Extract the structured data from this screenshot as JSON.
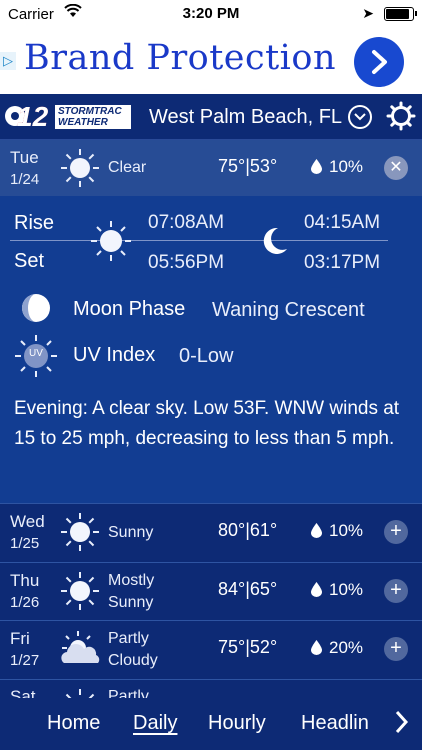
{
  "status_bar": {
    "carrier": "Carrier",
    "time": "3:20 PM",
    "battery_level": 0.9
  },
  "ad": {
    "text": "Brand Protection",
    "adchoices_glyph": "▷"
  },
  "header": {
    "logo_number": "12",
    "logo_line1": "STORMTRAC",
    "logo_line2": "WEATHER",
    "city": "West Palm Beach, FL"
  },
  "selected_day": {
    "day": "Tue",
    "date": "1/24",
    "condition": "Clear",
    "icon": "sun-icon",
    "hi": "75°",
    "lo": "53°",
    "separator": "|",
    "precip": "10%",
    "button": "✕"
  },
  "detail": {
    "rise_label": "Rise",
    "set_label": "Set",
    "sunrise": "07:08AM",
    "sunset": "05:56PM",
    "moonrise": "04:15AM",
    "moonset": "03:17PM",
    "moon_phase_label": "Moon Phase",
    "moon_phase_value": "Waning Crescent",
    "uv_label": "UV Index",
    "uv_value": "0-Low",
    "uv_badge": "UV",
    "summary": "Evening: A clear sky. Low 53F. WNW winds at 15 to 25 mph, decreasing to less than 5 mph."
  },
  "forecast": [
    {
      "day": "Wed",
      "date": "1/25",
      "cond1": "Sunny",
      "cond2": "",
      "icon": "sun-icon",
      "hi": "80°",
      "lo": "61°",
      "separator": "|",
      "precip": "10%",
      "button": "+"
    },
    {
      "day": "Thu",
      "date": "1/26",
      "cond1": "Mostly",
      "cond2": "Sunny",
      "icon": "sun-icon",
      "hi": "84°",
      "lo": "65°",
      "separator": "|",
      "precip": "10%",
      "button": "+"
    },
    {
      "day": "Fri",
      "date": "1/27",
      "cond1": "Partly",
      "cond2": "Cloudy",
      "icon": "partly-cloudy-icon",
      "hi": "75°",
      "lo": "52°",
      "separator": "|",
      "precip": "20%",
      "button": "+"
    },
    {
      "day": "Sat",
      "date": "",
      "cond1": "Partly",
      "cond2": "",
      "icon": "sun-icon",
      "hi": "",
      "lo": "",
      "separator": "",
      "precip": "",
      "button": ""
    }
  ],
  "tabs": [
    {
      "label": "Home",
      "active": false
    },
    {
      "label": "Daily",
      "active": true
    },
    {
      "label": "Hourly",
      "active": false
    },
    {
      "label": "Headlin",
      "active": false
    }
  ],
  "colors": {
    "background": "#0d2a75",
    "selected_row": "#274c95",
    "detail_panel": "#123d92",
    "ad_text": "#1a39c8"
  }
}
